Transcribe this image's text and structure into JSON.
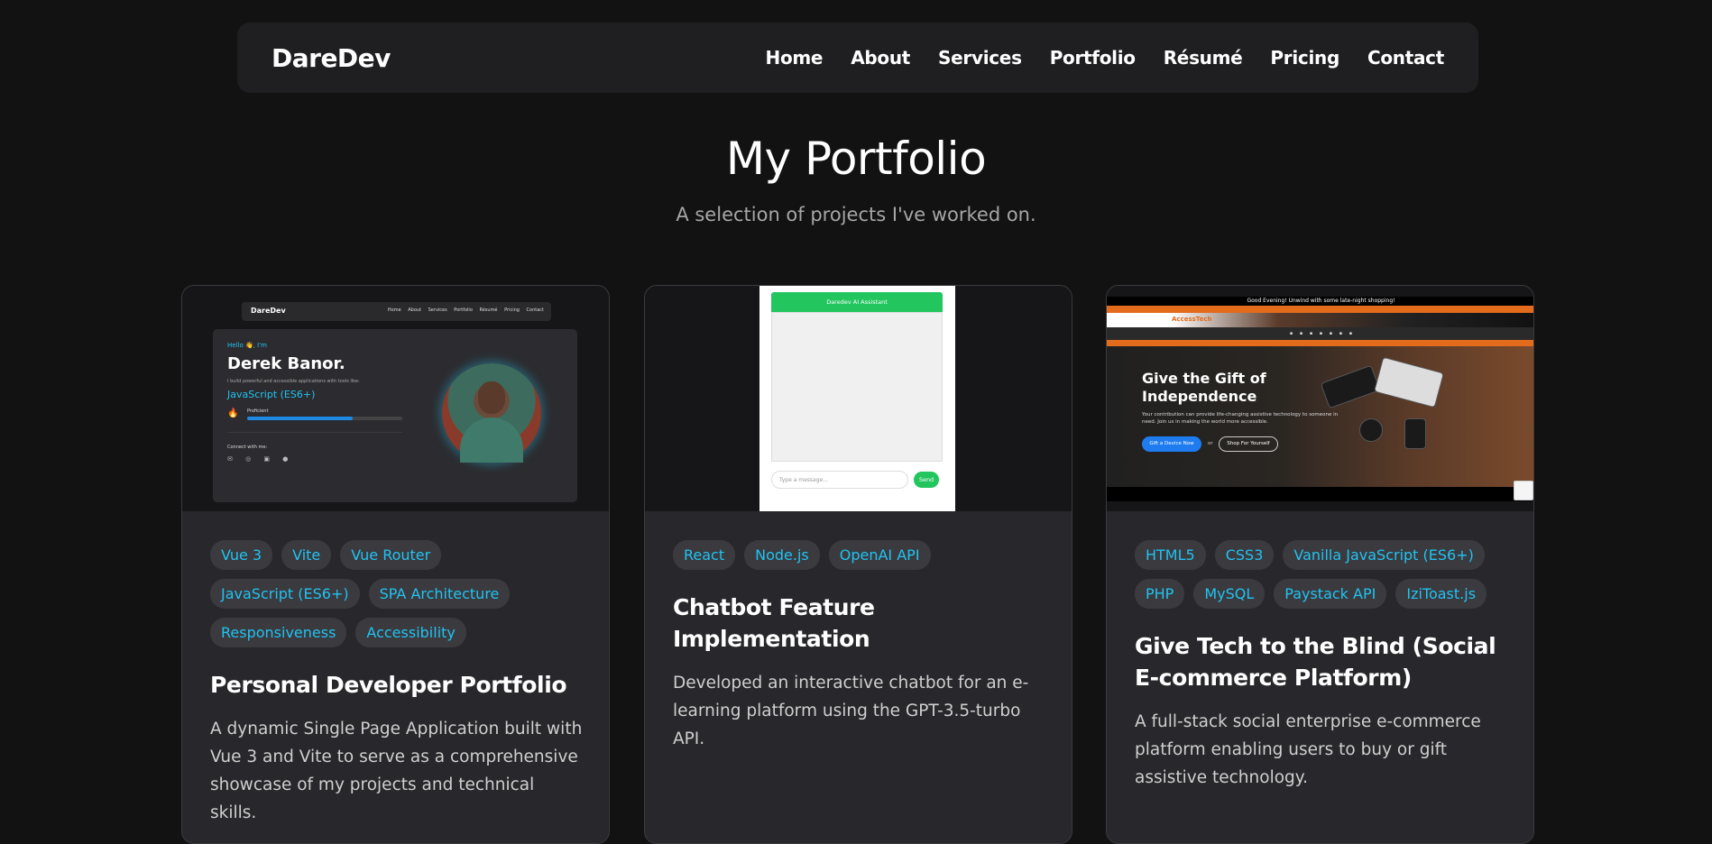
{
  "nav": {
    "brand": "DareDev",
    "links": [
      "Home",
      "About",
      "Services",
      "Portfolio",
      "Résumé",
      "Pricing",
      "Contact"
    ]
  },
  "hero": {
    "title": "My Portfolio",
    "subtitle": "A selection of projects I've worked on."
  },
  "projects": [
    {
      "tags": [
        "Vue 3",
        "Vite",
        "Vue Router",
        "JavaScript (ES6+)",
        "SPA Architecture",
        "Responsiveness",
        "Accessibility"
      ],
      "title": "Personal Developer Portfolio",
      "description": "A dynamic Single Page Application built with Vue 3 and Vite to serve as a comprehensive showcase of my projects and technical skills.",
      "thumb": {
        "brand": "DareDev",
        "links": "Home About Services Portfolio Résumé Pricing Contact",
        "hello": "Hello 👋, I'm",
        "name": "Derek Banor.",
        "tagline": "I build powerful and accessible applications with tools like:",
        "skill": "JavaScript (ES6+)",
        "proficiency": "Proficient",
        "proficiency_level": 0.68,
        "connect": "Connect with me:"
      }
    },
    {
      "tags": [
        "React",
        "Node.js",
        "OpenAI API"
      ],
      "title": "Chatbot Feature Implementation",
      "description": "Developed an interactive chatbot for an e-learning platform using the GPT-3.5-turbo API.",
      "thumb": {
        "header": "Daredev AI Assistant",
        "placeholder": "Type a message...",
        "send": "Send"
      }
    },
    {
      "tags": [
        "HTML5",
        "CSS3",
        "Vanilla JavaScript (ES6+)",
        "PHP",
        "MySQL",
        "Paystack API",
        "IziToast.js"
      ],
      "title": "Give Tech to the Blind (Social E-commerce Platform)",
      "description": "A full-stack social enterprise e-commerce platform enabling users to buy or gift assistive technology.",
      "thumb": {
        "topbar": "Good Evening! Unwind with some late-night shopping!",
        "logo": "AccessTech",
        "heading": "Give the Gift of Independence",
        "text": "Your contribution can provide life-changing assistive technology to someone in need. Join us in making the world more accessible.",
        "btn_primary": "Gift a Device Now",
        "or": "or",
        "btn_secondary": "Shop For Yourself"
      }
    }
  ],
  "colors": {
    "background": "#121212",
    "card": "#28282c",
    "tag_text": "#22c3f0",
    "tag_bg": "#3a3a3f"
  }
}
